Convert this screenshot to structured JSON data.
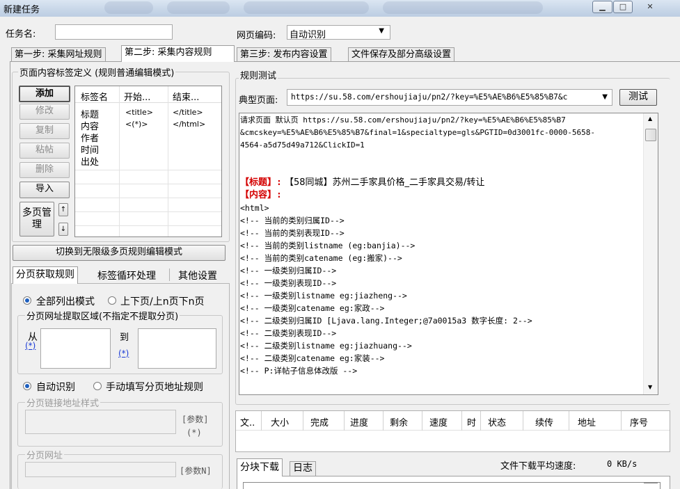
{
  "window": {
    "title": "新建任务",
    "minimize": "▁",
    "maximize": "□",
    "close": "✕"
  },
  "task_name": {
    "label": "任务名:",
    "value": ""
  },
  "page_encoding": {
    "label": "网页编码:",
    "value": "自动识别"
  },
  "tabs": [
    "第一步: 采集网址规则",
    "第二步: 采集内容规则",
    "第三步: 发布内容设置",
    "文件保存及部分高级设置"
  ],
  "tag_def": {
    "group_title": "页面内容标签定义 (规则普通编辑模式)",
    "buttons": {
      "add": "添加",
      "edit": "修改",
      "copy": "复制",
      "paste": "粘帖",
      "delete": "删除",
      "import": "导入",
      "multipage": "多页管理"
    },
    "columns": [
      "标签名",
      "开始...",
      "结束..."
    ],
    "rows": [
      {
        "name": "标题",
        "start": "<title>",
        "end": "</title>"
      },
      {
        "name": "内容",
        "start": "<(*)>",
        "end": "</html>"
      },
      {
        "name": "作者",
        "start": "",
        "end": ""
      },
      {
        "name": "时间",
        "start": "",
        "end": ""
      },
      {
        "name": "出处",
        "start": "",
        "end": ""
      }
    ],
    "switch_mode": "切换到无限级多页规则编辑模式"
  },
  "sub_tabs": [
    "分页获取规则",
    "标签循环处理",
    "其他设置"
  ],
  "paging": {
    "mode_all": "全部列出模式",
    "mode_prev_next": "上下页/上n页下n页",
    "region_title": "分页网址提取区域(不指定不提取分页)",
    "from": "从",
    "to": "到",
    "from_link": "(*)",
    "to_link": "(*)",
    "auto": "自动识别",
    "manual": "手动填写分页地址规则",
    "link_style_title": "分页链接地址样式",
    "param": "[参数]",
    "param_star": "(*)",
    "url_title": "分页网址",
    "param_n": "[参数N]"
  },
  "test": {
    "group_title": "规则测试",
    "typical_label": "典型页面:",
    "typical_url": "https://su.58.com/ershoujiaju/pn2/?key=%E5%AE%B6%E5%85%B7&c",
    "test_button": "测试",
    "output_lines": [
      {
        "type": "text",
        "text": "请求页面 默认页 https://su.58.com/ershoujiaju/pn2/?key=%E5%AE%B6%E5%85%B7"
      },
      {
        "type": "text",
        "text": "&cmcskey=%E5%AE%B6%E5%85%B7&final=1&specialtype=gls&PGTID=0d3001fc-0000-5658-"
      },
      {
        "type": "text",
        "text": "4564-a5d75d49a712&ClickID=1"
      },
      {
        "type": "blank",
        "text": ""
      },
      {
        "type": "blank",
        "text": ""
      },
      {
        "type": "label",
        "label": "【标题】:",
        "text": "【58同城】苏州二手家具价格_二手家具交易/转让"
      },
      {
        "type": "label",
        "label": "【内容】:",
        "text": ""
      },
      {
        "type": "text",
        "text": "<html>"
      },
      {
        "type": "text",
        "text": "<!--  当前的类别归属ID-->"
      },
      {
        "type": "text",
        "text": "<!--  当前的类别表现ID-->"
      },
      {
        "type": "text",
        "text": "<!--  当前的类别listname (eg:banjia)-->"
      },
      {
        "type": "text",
        "text": "<!--  当前的类别catename (eg:搬家)-->"
      },
      {
        "type": "text",
        "text": "<!--  一级类别归属ID-->"
      },
      {
        "type": "text",
        "text": "<!--  一级类别表现ID-->"
      },
      {
        "type": "text",
        "text": "<!--  一级类别listname eg:jiazheng-->"
      },
      {
        "type": "text",
        "text": "<!--  一级类别catename eg:家政-->"
      },
      {
        "type": "text",
        "text": "<!--  二级类别归属ID [Ljava.lang.Integer;@7a0015a3 数字长度: 2-->"
      },
      {
        "type": "text",
        "text": "<!--  二级类别表现ID-->"
      },
      {
        "type": "text",
        "text": "<!--  二级类别listname eg:jiazhuang-->"
      },
      {
        "type": "text",
        "text": "<!--  二级类别catename eg:家装-->"
      },
      {
        "type": "text",
        "text": "<!-- P:详帖子信息体改版 -->"
      }
    ]
  },
  "download": {
    "columns": [
      "文..",
      "大小",
      "完成",
      "进度",
      "剩余",
      "速度",
      "时",
      "状态",
      "续传",
      "地址",
      "序号"
    ],
    "tabs": [
      "分块下载",
      "日志"
    ],
    "avg_speed_label": "文件下载平均速度:",
    "avg_speed_value": "0 KB/s"
  }
}
